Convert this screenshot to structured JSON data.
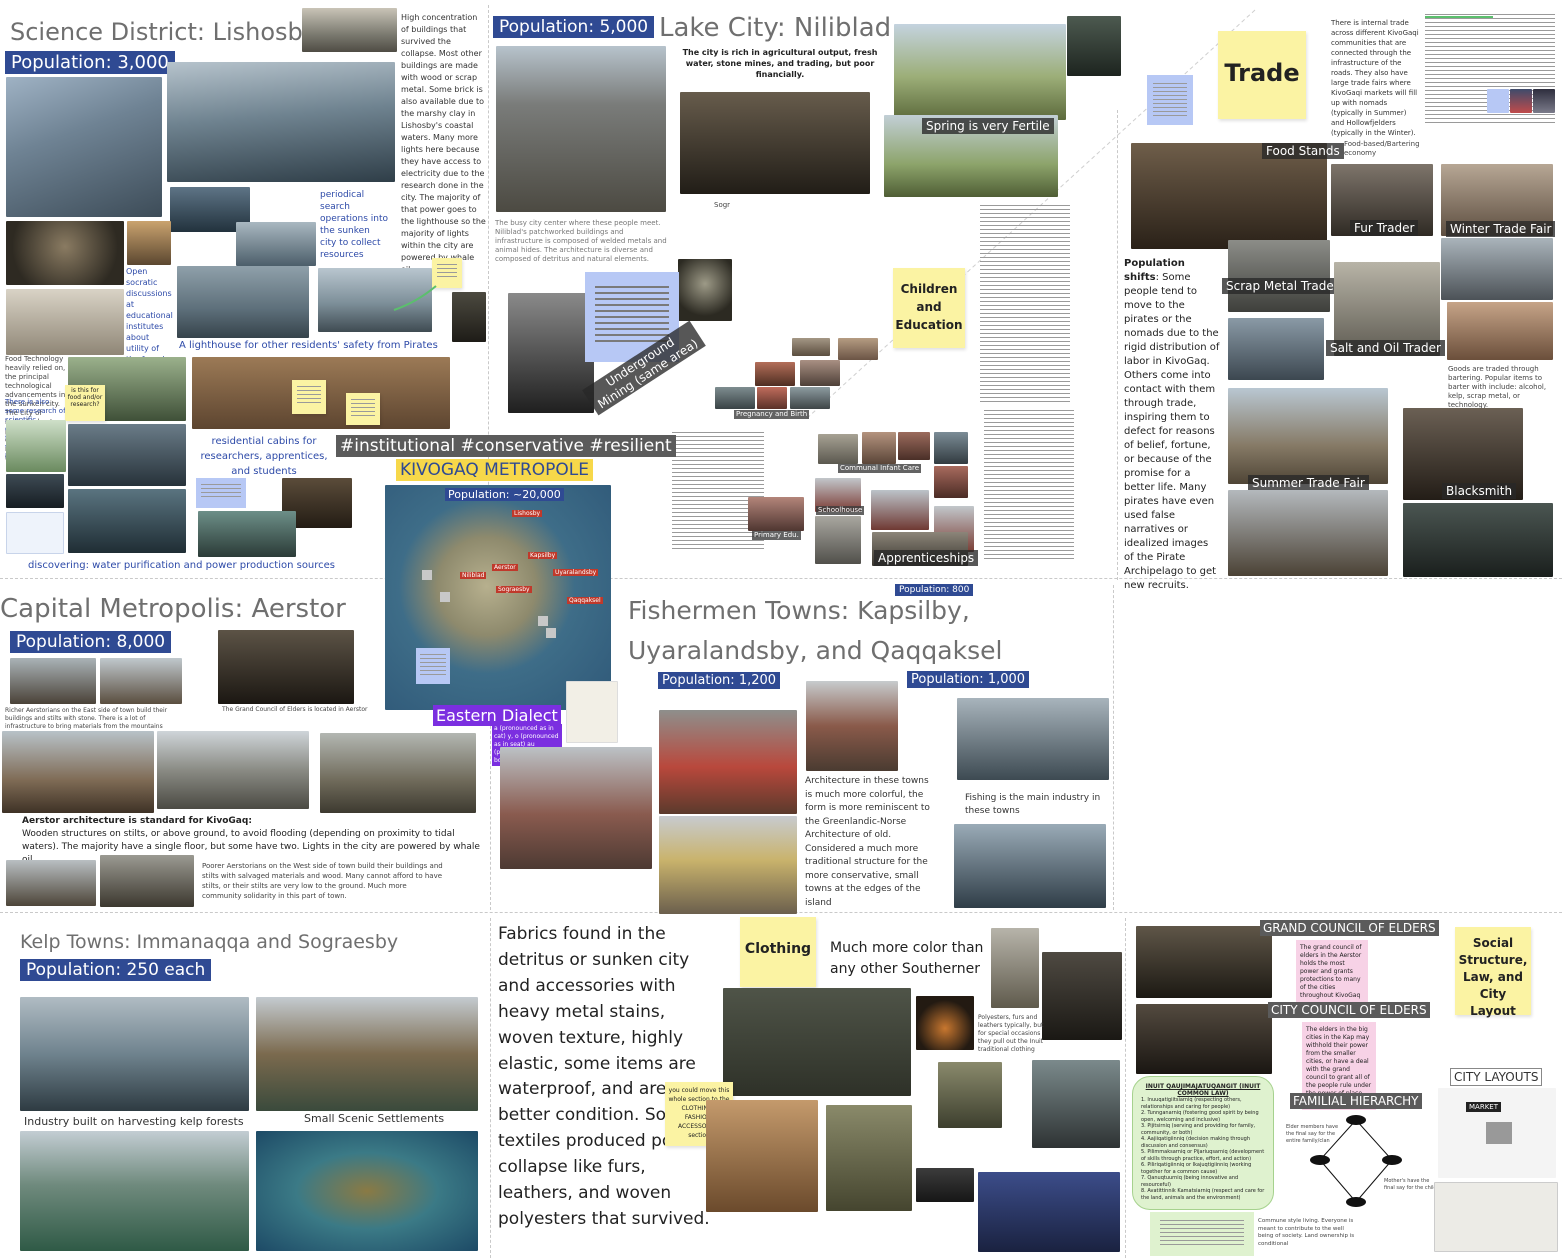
{
  "science": {
    "title": "Science District: Lishosby",
    "population": "Population: 3,000",
    "collapse_text": "High concentration of buildings that survived the collapse. Most other buildings are made with wood or scrap metal. Some brick is also available due to the marshy clay in Lishosby's coastal waters. Many more lights here because they have access to electricity due to the research done in the city. The majority of that power goes to the lighthouse so the majority of lights within the city are powered by whale oil.",
    "search_note": "periodical search operations into the sunken city to collect resources",
    "socratic_note": "Open socratic discussions at educational institutes about utility of the found components",
    "lighthouse_caption": "A lighthouse for other residents' safety from Pirates",
    "cabins_caption": "residential cabins for researchers, apprentices, and students",
    "discovering_caption": "discovering: water purification and power production sources",
    "food_tech_note": "Food Technology heavily relied on, the principal technological advancements in the sunken city. The city of Lishosby hosts prominent collective and research labs in the area...",
    "research_note": "There is also some research of scientific elements found from the trade with FJ via the Nomads",
    "sticky_note": "is this for food and/or research?"
  },
  "lake": {
    "population": "Population: 5,000",
    "title": "Lake City: Niliblad",
    "rich_text": "The city is rich in agricultural output, fresh water, stone mines, and trading, but poor financially.",
    "busy_text": "The busy city center where these people meet. Niliblad's patchworked buildings and infrastructure is composed of welded metals and animal hides. The architecture is diverse and composed of detritus and natural elements.",
    "photo_label": "Sogr",
    "spring_caption": "Spring is very Fertile",
    "mining_caption": "Underground Mining (same area)"
  },
  "children": {
    "sticky": "Children and Education",
    "pregnancy": "Pregnancy and Birth",
    "infant_care": "Communal Infant Care",
    "schoolhouse": "Schoolhouse",
    "primary": "Primary Edu.",
    "apprenticeships": "Apprenticeships"
  },
  "trade": {
    "sticky": "Trade",
    "internal_text": "There is internal trade across different KivoGaqi communities that are connected through the infrastructure of the roads. They also have large trade fairs where KivoGaqi markets will fill up with nomads (typically in Summer) and Hollowfjelders (typically in the Winter).",
    "food_based": "Food-based/Bartering economy",
    "labels": {
      "food_stands": "Food Stands",
      "fur_trader": "Fur Trader",
      "winter_fair": "Winter Trade Fair",
      "scrap_trader": "Scrap Metal Trader",
      "salt_oil": "Salt and Oil Trader",
      "summer_fair": "Summer Trade Fair",
      "blacksmith": "Blacksmith"
    },
    "shifts_label": "Population shifts",
    "shifts_text": ": Some people tend to move to the pirates or the nomads due to the rigid distribution of labor in KivoGaq. Others come into contact with them through trade, inspiring them to defect for reasons of belief, fortune, or because of the promise for a better life. Many pirates have even used false narratives or idealized images of the Pirate Archipelago to get new recruits.",
    "goods_text": "Goods are traded through bartering. Popular items to barter with include: alcohol, kelp, scrap metal, or technology."
  },
  "metropole": {
    "hashtags": "#institutional #conservative #resilient",
    "title": "KIVOGAQ METROPOLE",
    "population": "Population: ~20,000",
    "map_labels": [
      "Lishosby",
      "Niliblad",
      "Aerstor",
      "Uyaralandsby",
      "Sograesby",
      "Qaqqaksel",
      "Kapsilby"
    ],
    "dialect": "Eastern Dialect",
    "dialect_note": "a (pronounced as in cat) y, o (pronounced as in seat) au (pronounced as in bowl)",
    "pop_800": "Population: 800"
  },
  "capital": {
    "title": "Capital Metropolis: Aerstor",
    "population": "Population: 8,000",
    "richer_text": "Richer Aerstorians on the East side of town build their buildings and stilts with stone. There is a lot of infrastructure to bring materials from the mountains near Niliblad to the Aerstorian Bike.",
    "council_text": "The Grand Council of Elders is located in Aerstor",
    "arch_bold": "Aerstor architecture is standard for KivoGaq:",
    "arch_text": "Wooden structures on stilts, or above ground, to avoid flooding (depending on proximity to tidal waters). The majority have a single floor, but some have two. Lights in the city are powered by whale oil.",
    "poorer_text": "Poorer Aerstorians on the West side of town build their buildings and stilts with salvaged materials and wood. Many cannot afford to have stilts, or their stilts are very low to the ground. Much more community solidarity in this part of town."
  },
  "fishermen": {
    "title_line1": "Fishermen Towns: Kapsilby,",
    "title_line2": "Uyaralandsby, and Qaqqaksel",
    "population_a": "Population: 1,200",
    "population_b": "Population: 1,000",
    "arch_text": "Architecture in these towns is much more colorful, the form is more reminiscent to the Greenlandic-Norse Architecture of old. Considered a much more traditional structure for the more conservative, small towns at the edges of the island",
    "fishing_text": "Fishing is the main industry in these towns"
  },
  "kelp": {
    "title": "Kelp Towns:  Immanaqqa and Sograesby",
    "population": "Population: 250 each",
    "industry_caption": "Industry built on harvesting kelp forests",
    "scenic_caption": "Small Scenic Settlements"
  },
  "clothing": {
    "fabrics_text": "Fabrics found in the detritus or sunken city and accessories with heavy metal stains, woven texture, highly elastic, some items are waterproof, and are better condition. So textiles produced post collapse like furs, leathers, and woven polyesters that survived.",
    "sticky": "Clothing",
    "color_text": "Much more color than any other Southerner",
    "fur_note": "Polyesters, furs and leathers typically, but for special occasions they pull out the Inuit traditional clothing",
    "move_note": "you could move this whole section to the CLOTHING , FASHION, ACCESSORIES section"
  },
  "social": {
    "grand_council": "GRAND COUNCIL OF ELDERS",
    "grand_text": "The grand council of elders in the Aerstor holds the most power and grants protections to many of the cities throughout KivoGaq",
    "city_council": "CITY COUNCIL OF ELDERS",
    "city_text": "The elders in the big cities in the Kap may withhold their power from the smaller cities, or have a deal with the grand council to grant all of the people rule under the power of place resources.",
    "sticky": "Social Structure, Law, and City Layout",
    "city_layouts": "CITY LAYOUTS",
    "familial": "FAMILIAL HIERARCHY",
    "market": "MARKET",
    "laws_title": "INUIT QAUJIMAJATUQANGIT (INUIT COMMON LAW)",
    "laws": [
      "1. Inuuqatigiitsiarniq (respecting others, relationships and caring for people)",
      "2. Tunnganarniq (fostering good spirit by being open, welcoming and inclusive)",
      "3. Pijitsirniq (serving and providing for family, community, or both)",
      "4. Aajiiqatigiinniq (decision making through discussion and consensus)",
      "5. Pilimmaksarniq or Pijariuqsarniq (development of skills through practice, effort, and action)",
      "6. Piliriqatigiinniq or Ikajuqtigiinniq (working together for a common cause)",
      "7. Qanuqtuurniq (being innovative and resourceful)",
      "8. Avatittinnik Kamatsiarniq (respect and care for the land, animals and the environment)"
    ],
    "elder_note": "Elder members have the final say for the entire family/clan",
    "mother_note": "Mother's have the final say for the child",
    "commune_note": "Commune style living. Everyone is meant to contribute to the well being of society. Land ownership is conditional"
  }
}
